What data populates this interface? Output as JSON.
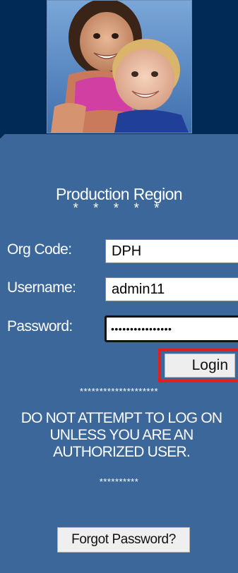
{
  "header": {
    "photo_description_icon": "children-photo"
  },
  "login": {
    "region_title": "Production Region",
    "region_stars": "* * * * *",
    "org_code_label": "Org Code:",
    "org_code_value": "DPH",
    "username_label": "Username:",
    "username_value": "admin11",
    "password_label": "Password:",
    "password_value": "••••••••••••••••",
    "login_button_label": "Login"
  },
  "notice": {
    "stars_top": "********************",
    "warning_text": "DO NOT ATTEMPT TO LOG ON UNLESS YOU ARE AN AUTHORIZED USER.",
    "stars_bottom": "**********"
  },
  "footer": {
    "forgot_password_label": "Forgot Password?"
  },
  "colors": {
    "panel_background": "#3b679a",
    "photo_band_background": "#022a57",
    "highlight_frame": "#e0201f"
  }
}
